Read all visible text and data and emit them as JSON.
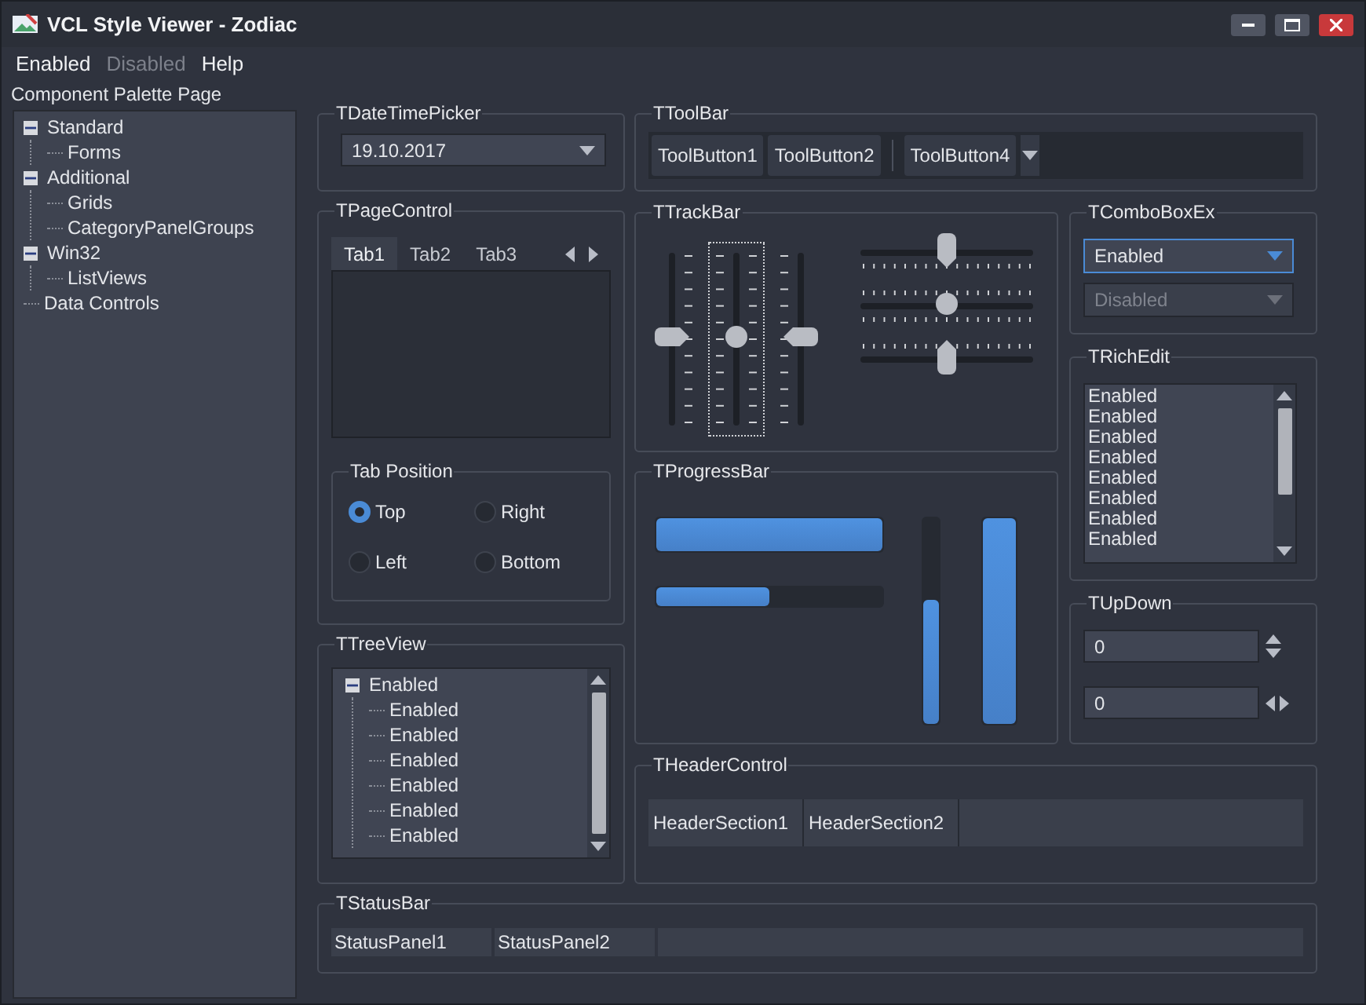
{
  "window": {
    "title": "VCL Style Viewer - Zodiac"
  },
  "menu": [
    {
      "label": "Enabled",
      "disabled": false
    },
    {
      "label": "Disabled",
      "disabled": true
    },
    {
      "label": "Help",
      "disabled": false
    }
  ],
  "sidebar": {
    "title": "Component Palette Page",
    "tree": [
      {
        "label": "Standard",
        "expanded": true,
        "children": [
          {
            "label": "Forms"
          }
        ]
      },
      {
        "label": "Additional",
        "expanded": true,
        "children": [
          {
            "label": "Grids"
          },
          {
            "label": "CategoryPanelGroups"
          }
        ]
      },
      {
        "label": "Win32",
        "expanded": true,
        "children": [
          {
            "label": "ListViews"
          }
        ]
      },
      {
        "label": "Data Controls"
      }
    ]
  },
  "date_time_picker": {
    "title": "TDateTimePicker",
    "value": "19.10.2017"
  },
  "tool_bar": {
    "title": "TToolBar",
    "items": [
      {
        "kind": "button",
        "label": "ToolButton1"
      },
      {
        "kind": "button",
        "label": "ToolButton2"
      },
      {
        "kind": "separator"
      },
      {
        "kind": "button",
        "label": "ToolButton4"
      },
      {
        "kind": "dropdown"
      }
    ]
  },
  "page_control": {
    "title": "TPageControl",
    "tabs": [
      {
        "label": "Tab1",
        "selected": true
      },
      {
        "label": "Tab2",
        "selected": false
      },
      {
        "label": "Tab3",
        "selected": false
      }
    ],
    "tab_position": {
      "title": "Tab Position",
      "options": [
        {
          "label": "Top",
          "selected": true
        },
        {
          "label": "Right",
          "selected": false
        },
        {
          "label": "Left",
          "selected": false
        },
        {
          "label": "Bottom",
          "selected": false
        }
      ]
    }
  },
  "tree_view": {
    "title": "TTreeView",
    "root": {
      "label": "Enabled",
      "expanded": true,
      "children": [
        {
          "label": "Enabled"
        },
        {
          "label": "Enabled"
        },
        {
          "label": "Enabled"
        },
        {
          "label": "Enabled"
        },
        {
          "label": "Enabled"
        },
        {
          "label": "Enabled"
        }
      ]
    }
  },
  "track_bar": {
    "title": "TTrackBar",
    "vertical_sliders": [
      {
        "kind": "after",
        "level": 0.5,
        "focused": false
      },
      {
        "kind": "both",
        "level": 0.5,
        "focused": true
      },
      {
        "kind": "before",
        "level": 0.5,
        "focused": false
      }
    ],
    "horizontal_sliders": [
      {
        "kind": "after",
        "level": 0.5,
        "focused": false
      },
      {
        "kind": "both",
        "level": 0.5,
        "focused": false
      },
      {
        "kind": "before",
        "level": 0.5,
        "focused": false
      }
    ]
  },
  "progress_bar": {
    "title": "TProgressBar",
    "bars": [
      {
        "kind": "horizontal",
        "level": 1.0
      },
      {
        "kind": "horizontal",
        "level": 0.5
      },
      {
        "kind": "vertical",
        "level": 0.6
      },
      {
        "kind": "vertical",
        "level": 1.0
      }
    ]
  },
  "combo_box_ex": {
    "title": "TComboBoxEx",
    "combos": [
      {
        "value": "Enabled",
        "disabled": false,
        "focused": true
      },
      {
        "value": "Disabled",
        "disabled": true,
        "focused": false
      }
    ]
  },
  "rich_edit": {
    "title": "TRichEdit",
    "lines": [
      "Enabled",
      "Enabled",
      "Enabled",
      "Enabled",
      "Enabled",
      "Enabled",
      "Enabled",
      "Enabled"
    ]
  },
  "up_down": {
    "title": "TUpDown",
    "fields": [
      {
        "value": "0",
        "kind": "vertical"
      },
      {
        "value": "0",
        "kind": "horizontal"
      }
    ]
  },
  "header_control": {
    "title": "THeaderControl",
    "sections": [
      "HeaderSection1",
      "HeaderSection2"
    ]
  },
  "status_bar": {
    "title": "TStatusBar",
    "panels": [
      "StatusPanel1",
      "StatusPanel2"
    ]
  }
}
